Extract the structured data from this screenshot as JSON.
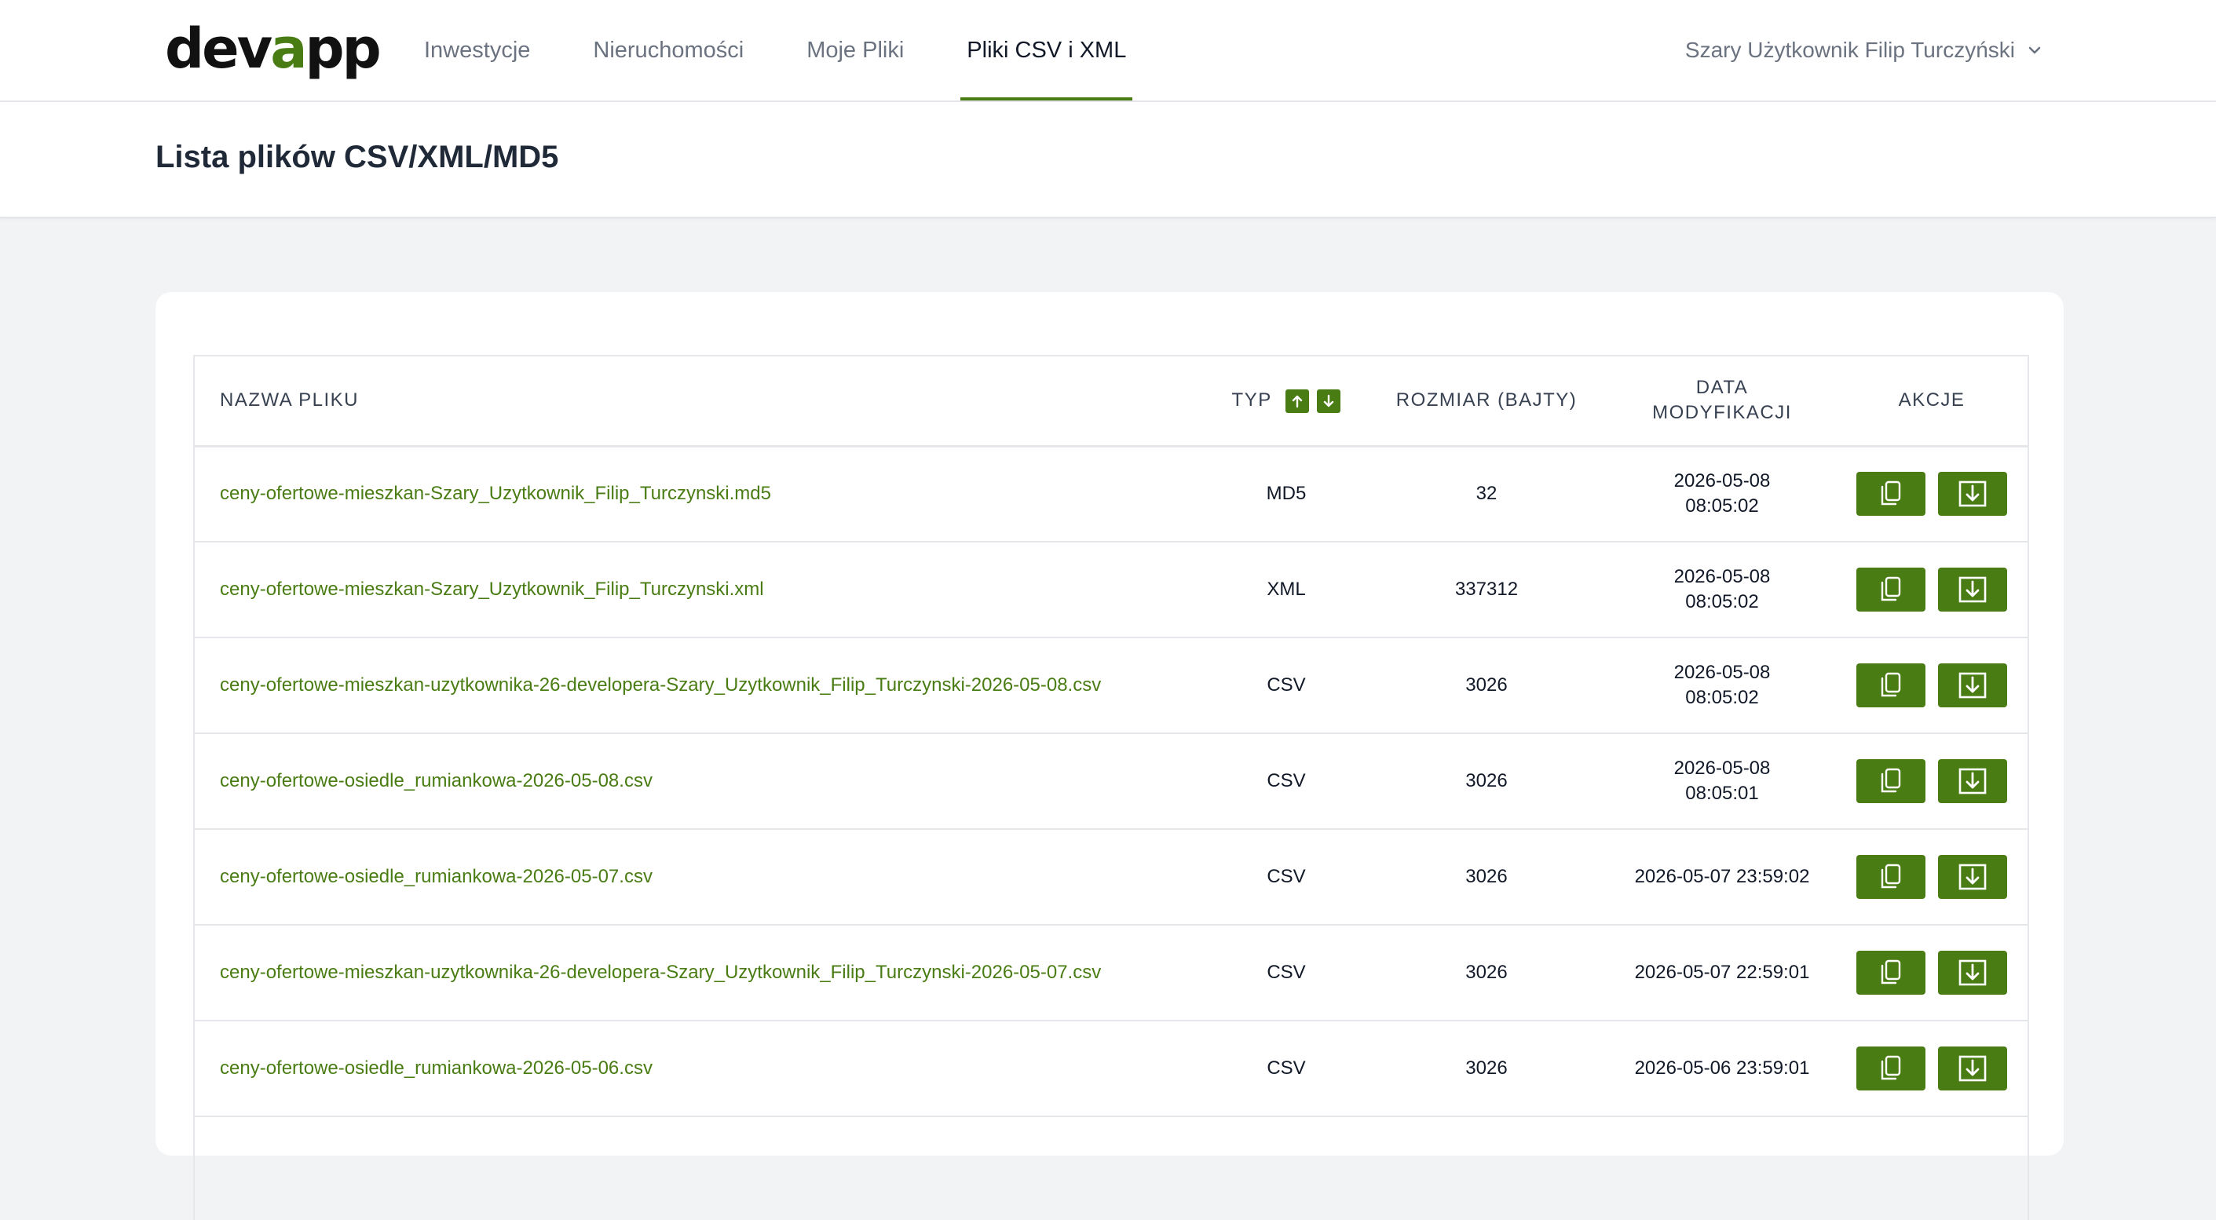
{
  "brand": {
    "logo_text_start": "dev",
    "logo_text_accent": "a",
    "logo_text_end": "pp"
  },
  "nav": {
    "items": [
      {
        "label": "Inwestycje"
      },
      {
        "label": "Nieruchomości"
      },
      {
        "label": "Moje Pliki"
      },
      {
        "label": "Pliki CSV i XML",
        "active": true
      }
    ]
  },
  "user": {
    "name": "Szary Użytkownik Filip Turczyński"
  },
  "page": {
    "title": "Lista plików CSV/XML/MD5"
  },
  "table": {
    "headers": {
      "name": "NAZWA PLIKU",
      "type": "TYP",
      "size": "ROZMIAR (BAJTY)",
      "date_line1": "DATA",
      "date_line2": "MODYFIKACJI",
      "actions": "AKCJE"
    },
    "rows": [
      {
        "name": "ceny-ofertowe-mieszkan-Szary_Uzytkownik_Filip_Turczynski.md5",
        "type": "MD5",
        "size": "32",
        "date": "2026-05-08",
        "time": "08:05:02"
      },
      {
        "name": "ceny-ofertowe-mieszkan-Szary_Uzytkownik_Filip_Turczynski.xml",
        "type": "XML",
        "size": "337312",
        "date": "2026-05-08",
        "time": "08:05:02"
      },
      {
        "name": "ceny-ofertowe-mieszkan-uzytkownika-26-developera-Szary_Uzytkownik_Filip_Turczynski-2026-05-08.csv",
        "type": "CSV",
        "size": "3026",
        "date": "2026-05-08",
        "time": "08:05:02"
      },
      {
        "name": "ceny-ofertowe-osiedle_rumiankowa-2026-05-08.csv",
        "type": "CSV",
        "size": "3026",
        "date": "2026-05-08",
        "time": "08:05:01"
      },
      {
        "name": "ceny-ofertowe-osiedle_rumiankowa-2026-05-07.csv",
        "type": "CSV",
        "size": "3026",
        "date": "2026-05-07",
        "time": "23:59:02"
      },
      {
        "name": "ceny-ofertowe-mieszkan-uzytkownika-26-developera-Szary_Uzytkownik_Filip_Turczynski-2026-05-07.csv",
        "type": "CSV",
        "size": "3026",
        "date": "2026-05-07",
        "time": "22:59:01"
      },
      {
        "name": "ceny-ofertowe-osiedle_rumiankowa-2026-05-06.csv",
        "type": "CSV",
        "size": "3026",
        "date": "2026-05-06",
        "time": "23:59:01"
      }
    ]
  },
  "icons": {
    "sort_asc": "arrow-up-icon",
    "sort_desc": "arrow-down-icon",
    "copy": "copy-icon",
    "download": "download-icon",
    "user_menu": "chevron-down-icon"
  },
  "colors": {
    "accent": "#4a7c14",
    "background": "#f2f3f5"
  }
}
